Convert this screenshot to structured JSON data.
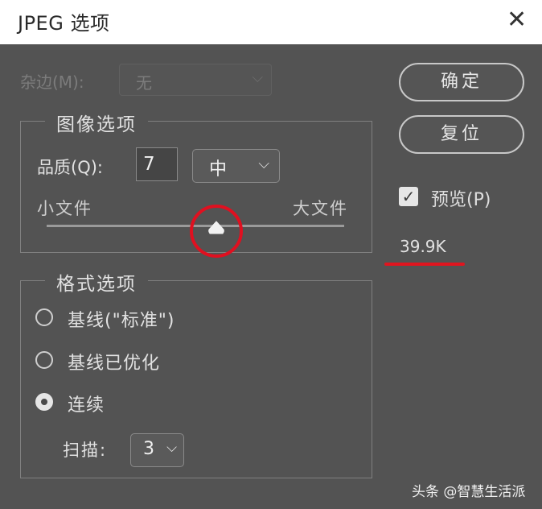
{
  "window": {
    "title": "JPEG 选项",
    "close_symbol": "✕"
  },
  "matte": {
    "label": "杂边(M):",
    "value": "无",
    "chevron": "⌵"
  },
  "buttons": {
    "ok_label": "确定",
    "reset_label": "复位"
  },
  "preview": {
    "label": "预览(P)",
    "checked": true,
    "check_symbol": "✓",
    "file_size": "39.9K"
  },
  "image_options": {
    "legend": "图像选项",
    "quality_label": "品质(Q):",
    "quality_value": "7",
    "quality_preset": "中",
    "chevron": "⌵",
    "small_file_label": "小文件",
    "large_file_label": "大文件",
    "slider_level": 0.57
  },
  "format_options": {
    "legend": "格式选项",
    "options": [
      {
        "label": "基线(\"标准\")",
        "selected": false
      },
      {
        "label": "基线已优化",
        "selected": false
      },
      {
        "label": "连续",
        "selected": true
      }
    ],
    "scan_label": "扫描:",
    "scan_value": "3",
    "chevron": "⌵"
  },
  "watermark": "头条 @智慧生活派",
  "colors": {
    "dialog_bg": "#535353",
    "highlight": "#e0151f"
  }
}
